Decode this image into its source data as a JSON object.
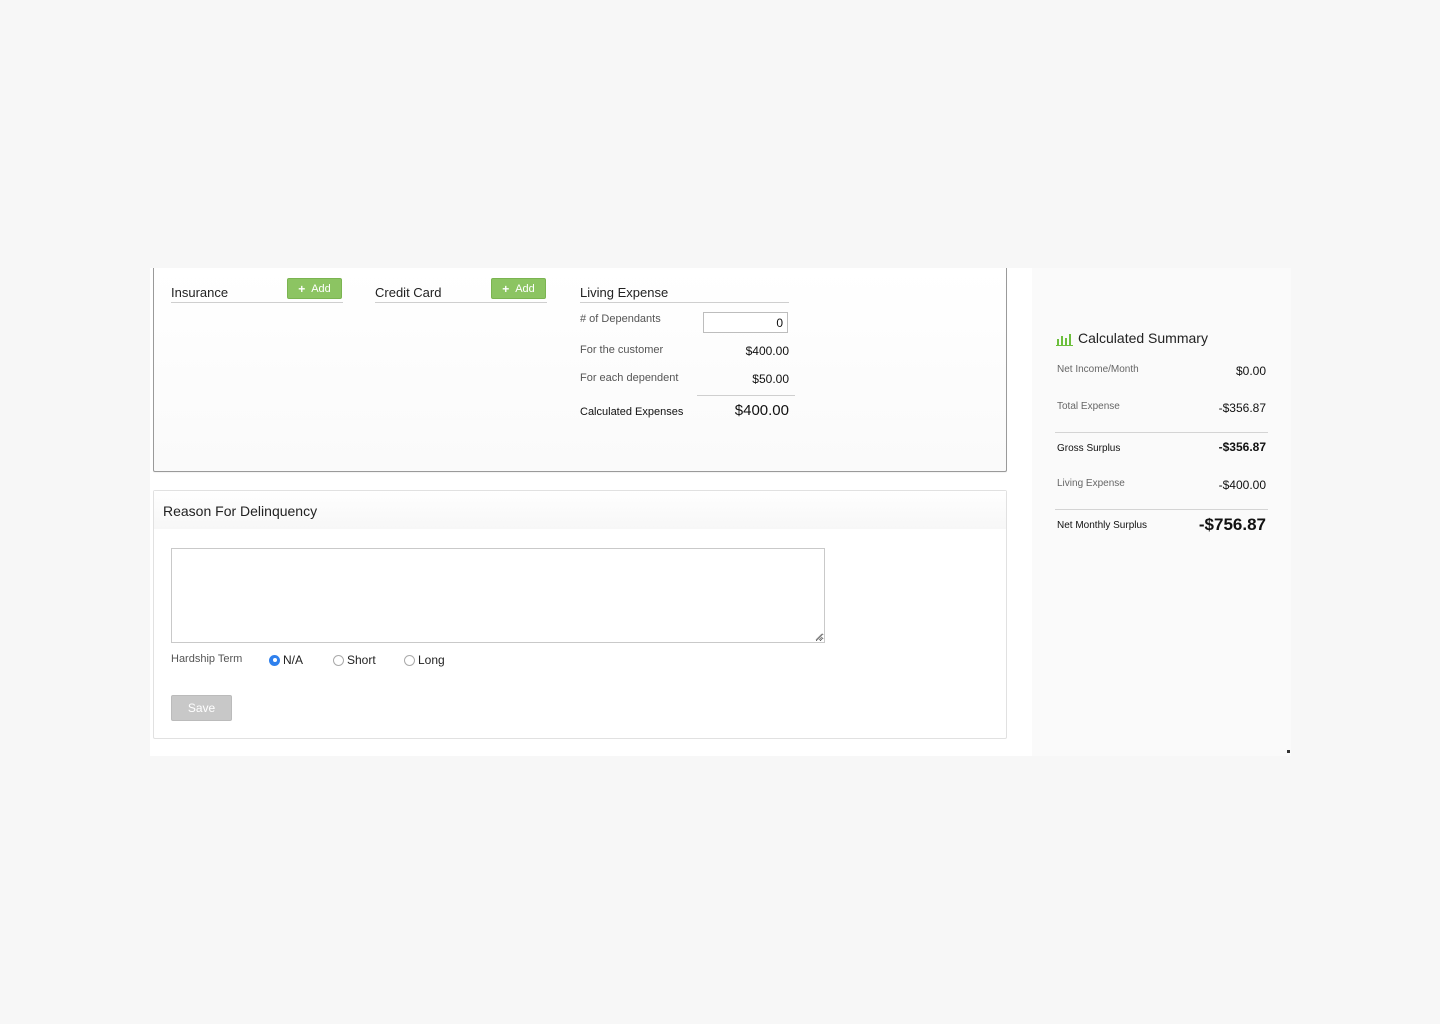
{
  "expenses": {
    "insurance": {
      "title": "Insurance",
      "add_label": "Add"
    },
    "credit_card": {
      "title": "Credit Card",
      "add_label": "Add"
    },
    "living_expense": {
      "title": "Living Expense",
      "rows": [
        {
          "label": "# of Dependants",
          "value": "0"
        },
        {
          "label": "For the customer",
          "value": "$400.00"
        },
        {
          "label": "For each dependent",
          "value": "$50.00"
        }
      ],
      "total_label": "Calculated Expenses",
      "total_value": "$400.00"
    }
  },
  "reason": {
    "title": "Reason For Delinquency",
    "textarea_value": "",
    "hardship_label": "Hardship Term",
    "options": [
      {
        "label": "N/A",
        "selected": true
      },
      {
        "label": "Short",
        "selected": false
      },
      {
        "label": "Long",
        "selected": false
      }
    ],
    "save_label": "Save"
  },
  "summary": {
    "title": "Calculated Summary",
    "icon": "bar-chart-icon",
    "accent": "#6cbf3c",
    "rows": [
      {
        "label": "Net Income/Month",
        "value": "$0.00"
      },
      {
        "label": "Total Expense",
        "value": "-$356.87"
      },
      {
        "label": "Gross Surplus",
        "value": "-$356.87"
      },
      {
        "label": "Living Expense",
        "value": "-$400.00"
      },
      {
        "label": "Net Monthly Surplus",
        "value": "-$756.87"
      }
    ]
  },
  "colors": {
    "add_button": "#8cc462",
    "radio_selected": "#2f80ed",
    "save_button_disabled": "#c8c8c8"
  }
}
